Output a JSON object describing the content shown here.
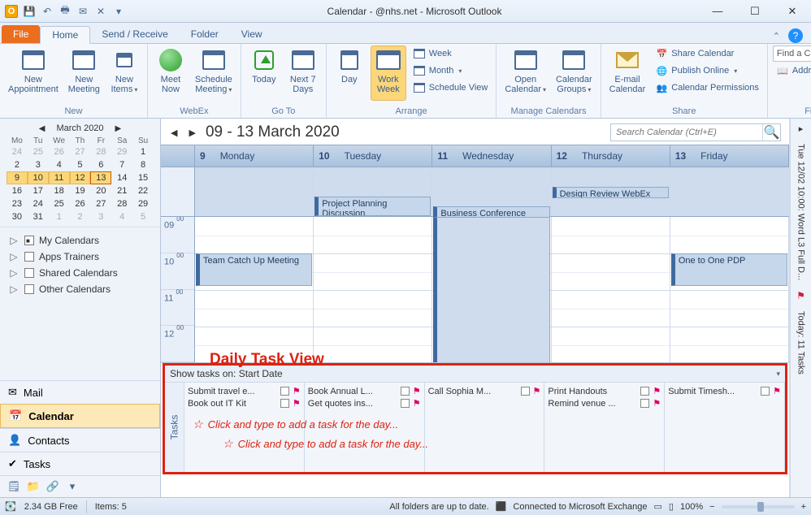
{
  "title": "Calendar -            @nhs.net - Microsoft Outlook",
  "qat_icons": [
    "save",
    "undo",
    "print",
    "send-receive",
    "delete"
  ],
  "tabs": {
    "file": "File",
    "items": [
      "Home",
      "Send / Receive",
      "Folder",
      "View"
    ],
    "active": 0
  },
  "ribbon": {
    "new": {
      "label": "New",
      "appointment": "New\nAppointment",
      "meeting": "New\nMeeting",
      "items": "New\nItems"
    },
    "webex": {
      "label": "WebEx",
      "meet_now": "Meet\nNow",
      "schedule": "Schedule\nMeeting"
    },
    "goto": {
      "label": "Go To",
      "today": "Today",
      "next7": "Next 7\nDays"
    },
    "arrange": {
      "label": "Arrange",
      "day": "Day",
      "workweek": "Work\nWeek",
      "week": "Week",
      "month": "Month",
      "schedule_view": "Schedule View"
    },
    "manage": {
      "label": "Manage Calendars",
      "open": "Open\nCalendar",
      "groups": "Calendar\nGroups"
    },
    "share": {
      "label": "Share",
      "email": "E-mail\nCalendar",
      "share_cal": "Share Calendar",
      "publish": "Publish Online",
      "perms": "Calendar Permissions"
    },
    "find": {
      "label": "Find",
      "contact_ph": "Find a Contact",
      "addressbook": "Address Book"
    }
  },
  "date_nav": {
    "month_label": "March 2020",
    "dow": [
      "Mo",
      "Tu",
      "We",
      "Th",
      "Fr",
      "Sa",
      "Su"
    ],
    "days": [
      {
        "n": "24",
        "dim": true
      },
      {
        "n": "25",
        "dim": true
      },
      {
        "n": "26",
        "dim": true
      },
      {
        "n": "27",
        "dim": true
      },
      {
        "n": "28",
        "dim": true
      },
      {
        "n": "29",
        "dim": true
      },
      {
        "n": "1"
      },
      {
        "n": "2"
      },
      {
        "n": "3"
      },
      {
        "n": "4"
      },
      {
        "n": "5"
      },
      {
        "n": "6"
      },
      {
        "n": "7"
      },
      {
        "n": "8"
      },
      {
        "n": "9",
        "sel": true
      },
      {
        "n": "10",
        "sel": true
      },
      {
        "n": "11",
        "sel": true
      },
      {
        "n": "12",
        "sel": true
      },
      {
        "n": "13",
        "sel": true,
        "today": true
      },
      {
        "n": "14"
      },
      {
        "n": "15"
      },
      {
        "n": "16"
      },
      {
        "n": "17"
      },
      {
        "n": "18"
      },
      {
        "n": "19"
      },
      {
        "n": "20"
      },
      {
        "n": "21"
      },
      {
        "n": "22"
      },
      {
        "n": "23"
      },
      {
        "n": "24"
      },
      {
        "n": "25"
      },
      {
        "n": "26"
      },
      {
        "n": "27"
      },
      {
        "n": "28"
      },
      {
        "n": "29"
      },
      {
        "n": "30"
      },
      {
        "n": "31"
      },
      {
        "n": "1",
        "dim": true
      },
      {
        "n": "2",
        "dim": true
      },
      {
        "n": "3",
        "dim": true
      },
      {
        "n": "4",
        "dim": true
      },
      {
        "n": "5",
        "dim": true
      }
    ]
  },
  "calendar_groups": [
    {
      "label": "My Calendars",
      "checked": true
    },
    {
      "label": "Apps Trainers",
      "checked": false
    },
    {
      "label": "Shared Calendars",
      "checked": false
    },
    {
      "label": "Other Calendars",
      "checked": false
    }
  ],
  "nav_buttons": [
    "Mail",
    "Calendar",
    "Contacts",
    "Tasks"
  ],
  "nav_active": 1,
  "cal_title": "09 - 13 March 2020",
  "search_ph": "Search Calendar (Ctrl+E)",
  "day_headers": [
    {
      "num": "9",
      "name": "Monday"
    },
    {
      "num": "10",
      "name": "Tuesday"
    },
    {
      "num": "11",
      "name": "Wednesday"
    },
    {
      "num": "12",
      "name": "Thursday"
    },
    {
      "num": "13",
      "name": "Friday"
    }
  ],
  "hours": [
    "09",
    "10",
    "11",
    "12"
  ],
  "appts": {
    "project_planning": "Project Planning Discussion",
    "business_conf": "Business Conference",
    "design_review": "Design Review WebEx",
    "team_catchup": "Team Catch Up Meeting",
    "one_to_one": "One to One PDP"
  },
  "dtv_label": "Daily Task View",
  "tasks_header": "Show tasks on: Start Date",
  "tasks_gutter": "Tasks",
  "task_cols": [
    [
      {
        "t": "Submit travel e..."
      },
      {
        "t": "Book out IT Kit"
      }
    ],
    [
      {
        "t": "Book Annual L..."
      },
      {
        "t": "Get quotes ins..."
      }
    ],
    [
      {
        "t": "Call Sophia M..."
      }
    ],
    [
      {
        "t": "Print Handouts"
      },
      {
        "t": "Remind venue ..."
      }
    ],
    [
      {
        "t": "Submit Timesh..."
      }
    ]
  ],
  "add_task_prompt": "Click and type to add a task for the day...",
  "todobar": {
    "seg1": "Tue 12/02 10:00: Word L3 Full D...",
    "seg2": "Today: 11 Tasks"
  },
  "status": {
    "gb": "2.34 GB Free",
    "items": "Items: 5",
    "uptodate": "All folders are up to date.",
    "connected": "Connected to Microsoft Exchange",
    "zoom": "100%"
  }
}
